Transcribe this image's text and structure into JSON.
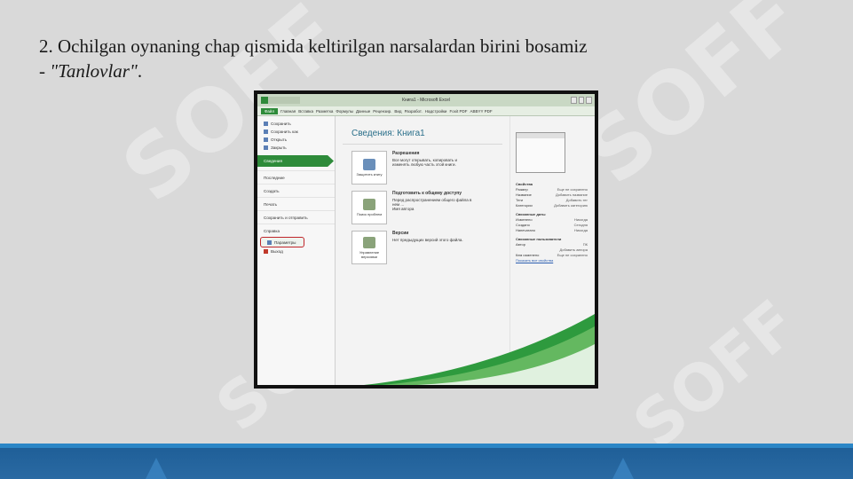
{
  "caption": {
    "line1": "2. Ochilgan oynaning chap qismida keltirilgan narsalardan birini bosamiz",
    "line2_prefix": "- ",
    "option": "\"Tanlovlar\"",
    "line2_suffix": "."
  },
  "watermark": {
    "text": "SOFF"
  },
  "excel": {
    "title": "Книга1 - Microsoft Excel",
    "tabs": [
      "Файл",
      "Главная",
      "Вставка",
      "Разметка",
      "Формулы",
      "Данные",
      "Рецензир.",
      "Вид",
      "Разработ.",
      "Надстройки",
      "Foxit PDF",
      "ABBYY PDF"
    ],
    "nav": {
      "save": "Сохранить",
      "save_as": "Сохранить как",
      "open": "Открыть",
      "close": "Закрыть",
      "info": "Сведения",
      "recent": "Последние",
      "new": "Создать",
      "print": "Печать",
      "share": "Сохранить и отправить",
      "help": "Справка",
      "options": "Параметры",
      "exit": "Выход"
    },
    "main": {
      "heading": "Сведения: Книга1",
      "permissions": {
        "button": "Защитить книгу",
        "title": "Разрешения",
        "text": "Все могут открывать, копировать и изменять любую часть этой книги."
      },
      "prepare": {
        "button": "Поиск проблем",
        "title": "Подготовить к общему доступу",
        "text": "Перед распространением общего файла в нем ...",
        "author": "Имя автора"
      },
      "versions": {
        "button": "Управление версиями",
        "title": "Версии",
        "text": "Нет предыдущих версий этого файла."
      }
    },
    "props": {
      "header": "Свойства",
      "size": [
        "Размер",
        "Еще не сохранено"
      ],
      "title": [
        "Название",
        "Добавить название"
      ],
      "tags": [
        "Теги",
        "Добавить тег"
      ],
      "categories": [
        "Категории",
        "Добавить категорию"
      ],
      "dates_header": "Связанные даты",
      "modified": [
        "Изменено",
        "Никогда"
      ],
      "created": [
        "Создано",
        "Сегодня"
      ],
      "printed": [
        "Напечатано",
        "Никогда"
      ],
      "people_header": "Связанные пользователи",
      "author": [
        "Автор",
        "ПК"
      ],
      "add_author": "Добавить автора",
      "last_modified_by": [
        "Кем изменено",
        "Еще не сохранено"
      ],
      "show_all": "Показать все свойства"
    }
  }
}
